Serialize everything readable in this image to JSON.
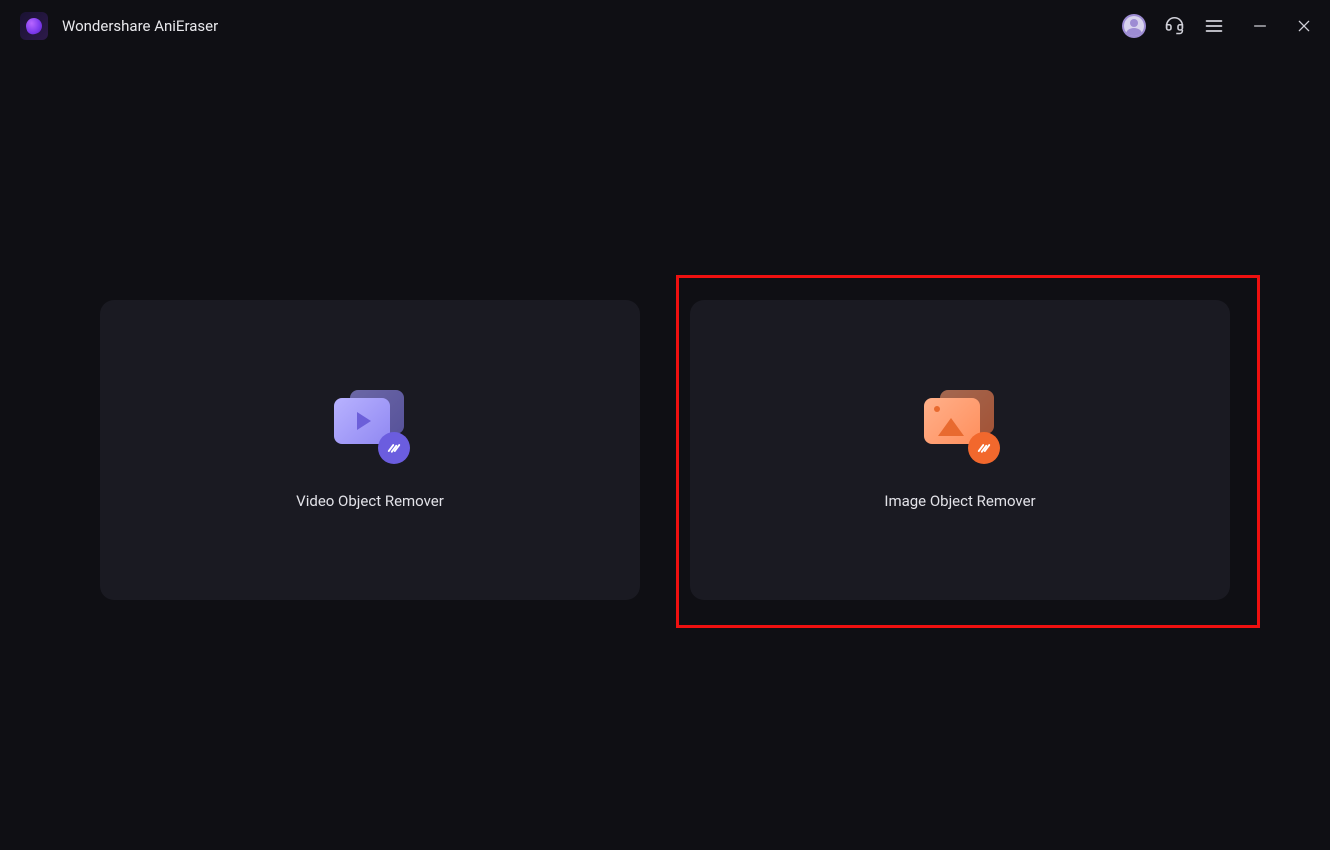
{
  "app": {
    "title": "Wondershare AniEraser"
  },
  "cards": {
    "video": {
      "label": "Video Object Remover"
    },
    "image": {
      "label": "Image Object Remover"
    }
  }
}
